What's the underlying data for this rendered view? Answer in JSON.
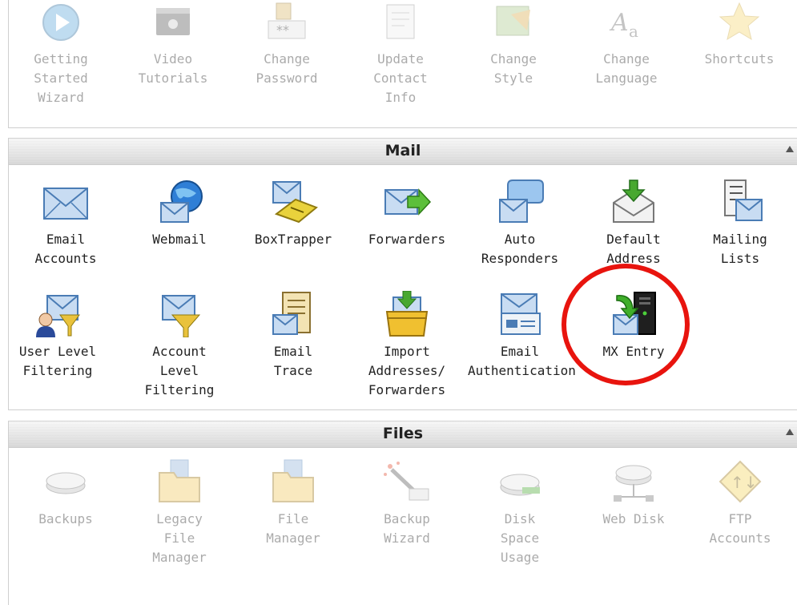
{
  "top": {
    "items": [
      {
        "label": "Getting\nStarted\nWizard",
        "icon": "play-icon"
      },
      {
        "label": "Video\nTutorials",
        "icon": "film-icon"
      },
      {
        "label": "Change\nPassword",
        "icon": "password-icon"
      },
      {
        "label": "Update\nContact\nInfo",
        "icon": "contact-icon"
      },
      {
        "label": "Change\nStyle",
        "icon": "style-icon"
      },
      {
        "label": "Change\nLanguage",
        "icon": "language-icon"
      },
      {
        "label": "Shortcuts",
        "icon": "star-icon"
      }
    ]
  },
  "mail": {
    "title": "Mail",
    "items": [
      {
        "label": "Email\nAccounts",
        "icon": "envelope-icon"
      },
      {
        "label": "Webmail",
        "icon": "globe-mail-icon"
      },
      {
        "label": "BoxTrapper",
        "icon": "trap-mail-icon"
      },
      {
        "label": "Forwarders",
        "icon": "forward-mail-icon"
      },
      {
        "label": "Auto\nResponders",
        "icon": "speech-mail-icon"
      },
      {
        "label": "Default\nAddress",
        "icon": "download-mail-icon"
      },
      {
        "label": "Mailing\nLists",
        "icon": "list-mail-icon"
      },
      {
        "label": "User Level\nFiltering",
        "icon": "user-filter-icon"
      },
      {
        "label": "Account\nLevel\nFiltering",
        "icon": "funnel-mail-icon"
      },
      {
        "label": "Email\nTrace",
        "icon": "document-mail-icon"
      },
      {
        "label": "Import\nAddresses/\nForwarders",
        "icon": "import-box-icon"
      },
      {
        "label": "Email\nAuthentication",
        "icon": "auth-card-icon"
      },
      {
        "label": "MX Entry",
        "icon": "mx-server-icon"
      }
    ]
  },
  "files": {
    "title": "Files",
    "items": [
      {
        "label": "Backups",
        "icon": "disk-icon"
      },
      {
        "label": "Legacy\nFile\nManager",
        "icon": "folder-icon"
      },
      {
        "label": "File\nManager",
        "icon": "folder-icon"
      },
      {
        "label": "Backup\nWizard",
        "icon": "wand-icon"
      },
      {
        "label": "Disk\nSpace\nUsage",
        "icon": "disk-usage-icon"
      },
      {
        "label": "Web Disk",
        "icon": "network-disk-icon"
      },
      {
        "label": "FTP\nAccounts",
        "icon": "ftp-icon"
      }
    ]
  },
  "colors": {
    "highlight_ring": "#e8140e",
    "faded_text": "#8a8a8a"
  }
}
